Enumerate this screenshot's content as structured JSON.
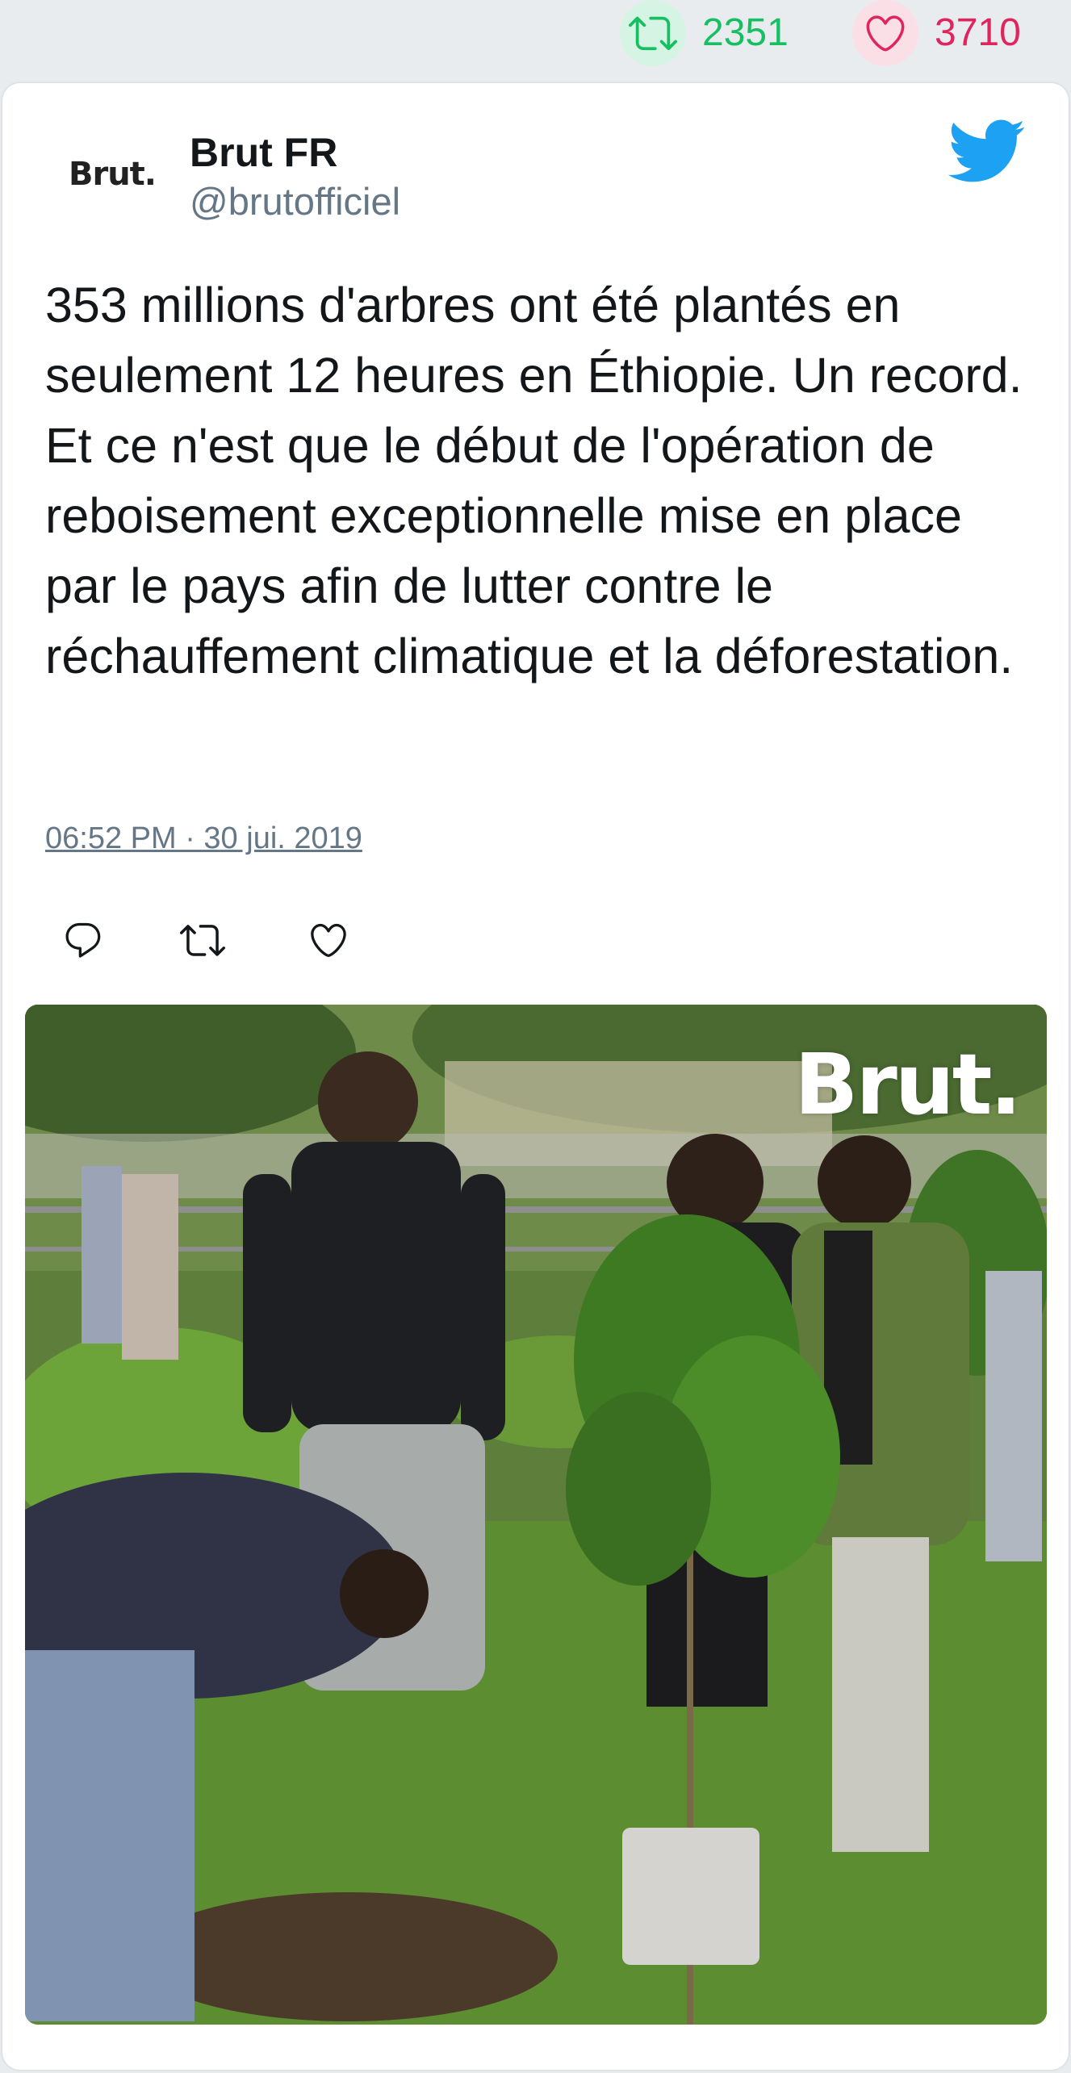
{
  "stats": {
    "retweet_count": "2351",
    "like_count": "3710",
    "retweet_color": "#17bf63",
    "like_color": "#e0245e"
  },
  "tweet": {
    "author": {
      "display_name": "Brut FR",
      "handle": "@brutofficiel",
      "avatar_text": "Brut."
    },
    "text": "353 millions d'arbres ont été plantés en seulement 12 heures en Éthiopie. Un record. Et ce n'est que le début de l'opération de reboisement exceptionnelle mise en place par le pays afin de lutter contre le réchauffement climatique et la déforestation.",
    "timestamp": "06:52 PM · 30 jui. 2019",
    "actions": [
      "reply-icon",
      "retweet-icon",
      "like-icon"
    ],
    "media": {
      "watermark": "Brut."
    },
    "brand_icon": "twitter-bird-icon",
    "brand_color": "#1da1f2"
  }
}
